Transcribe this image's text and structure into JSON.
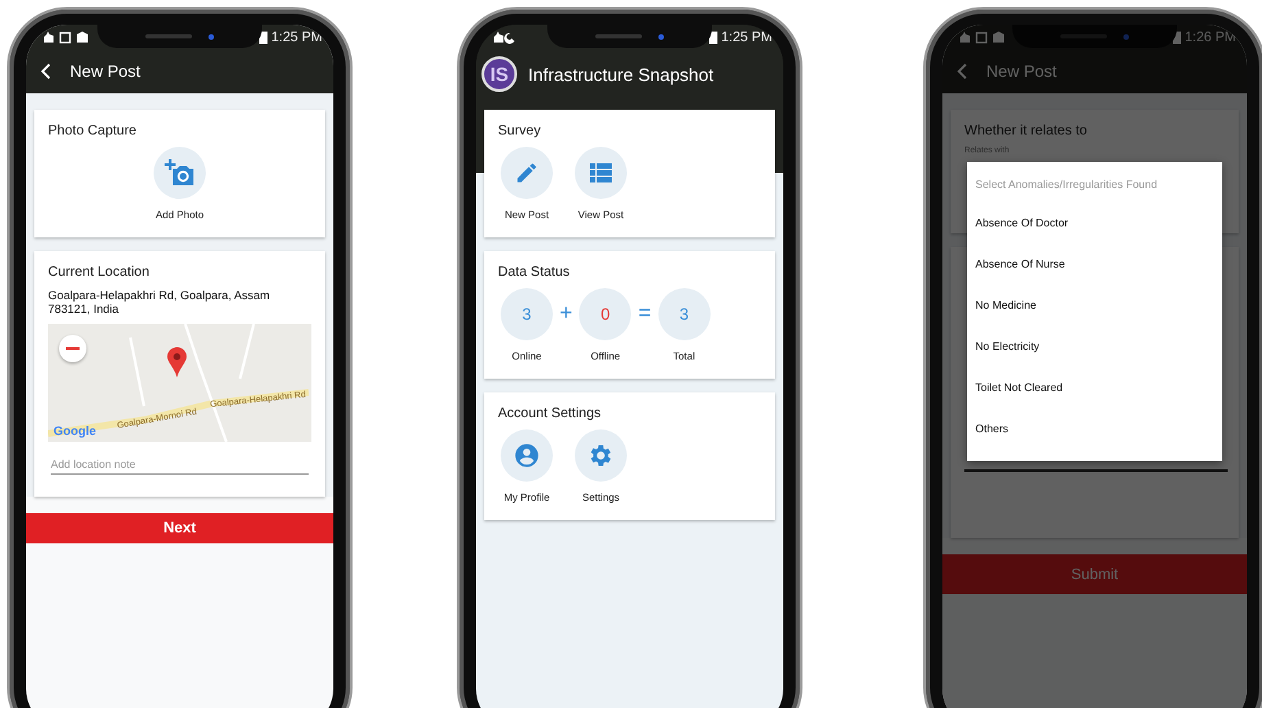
{
  "phones": [
    {
      "kind": "new_post",
      "status_time": "1:25 PM",
      "title": "New Post",
      "photo_card": {
        "title": "Photo Capture",
        "action": "Add Photo"
      },
      "location_card": {
        "title": "Current Location",
        "address": "Goalpara-Helapakhri Rd, Goalpara, Assam 783121, India",
        "map_labels": [
          "Goalpara-Helapakhri Rd",
          "Goalpara-Mornoi Rd"
        ],
        "map_brand": "Google",
        "note": {
          "placeholder": "Add location note"
        }
      },
      "button": "Next"
    },
    {
      "kind": "dashboard",
      "status_time": "1:25 PM",
      "logo": "IS",
      "title": "Infrastructure Snapshot",
      "sections": [
        {
          "kind": "actions",
          "title": "Survey",
          "items": [
            {
              "label": "New Post"
            },
            {
              "label": "View Post"
            }
          ]
        },
        {
          "kind": "counts",
          "title": "Data Status",
          "operators": [
            "+",
            "="
          ],
          "items": [
            {
              "value": "3",
              "label": "Online",
              "color": "#3b8fd8"
            },
            {
              "value": "0",
              "label": "Offline",
              "color": "#e53935"
            },
            {
              "value": "3",
              "label": "Total",
              "color": "#3b8fd8"
            }
          ]
        },
        {
          "kind": "actions",
          "title": "Account Settings",
          "items": [
            {
              "label": "My Profile"
            },
            {
              "label": "Settings"
            }
          ]
        }
      ]
    },
    {
      "kind": "form_dialog",
      "status_time": "1:26 PM",
      "title": "New Post",
      "card_title": "Whether it relates to",
      "field_label": "Relates with",
      "button": "Submit",
      "dialog": {
        "prompt": "Select Anomalies/Irregularities Found",
        "options": [
          "Absence Of Doctor",
          "Absence Of Nurse",
          "No Medicine",
          "No Electricity",
          "Toilet Not Cleared",
          "Others"
        ]
      }
    }
  ]
}
